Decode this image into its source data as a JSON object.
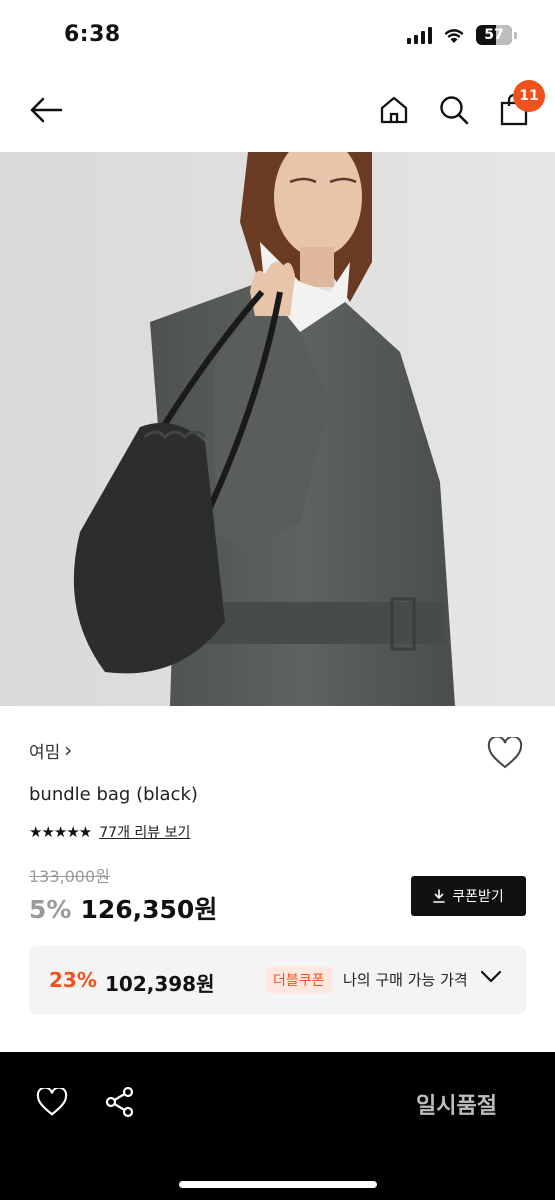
{
  "status_bar": {
    "time": "6:38",
    "battery_percent": "57",
    "battery_level": 0.57,
    "icons": [
      "cellular-signal-icon",
      "wifi-icon",
      "battery-icon"
    ]
  },
  "nav": {
    "back_icon": "arrow-left-icon",
    "home_icon": "home-icon",
    "search_icon": "search-icon",
    "cart_icon": "shopping-bag-icon",
    "cart_count": "11"
  },
  "product": {
    "brand": "여밈",
    "brand_chevron": "›",
    "name": "bundle bag (black)",
    "rating_stars": "★★★★★",
    "rating_value": 5,
    "review_link": "77개 리뷰 보기",
    "original_price": "133,000원",
    "discount_rate": "5%",
    "sale_price": "126,350원",
    "coupon_button_label": "쿠폰받기",
    "best_price": {
      "rate": "23%",
      "price": "102,398원",
      "coupon_tag": "더블쿠폰",
      "label": "나의 구매 가능 가격"
    }
  },
  "bottom_bar": {
    "wish_icon": "heart-outline-icon",
    "share_icon": "share-icon",
    "status_label": "일시품절"
  },
  "colors": {
    "accent": "#f0521e",
    "accent_light": "#fde7df",
    "muted": "#9a9a9a",
    "bottom_bar_bg": "#000000",
    "soldout_text": "#bdbdbd"
  }
}
